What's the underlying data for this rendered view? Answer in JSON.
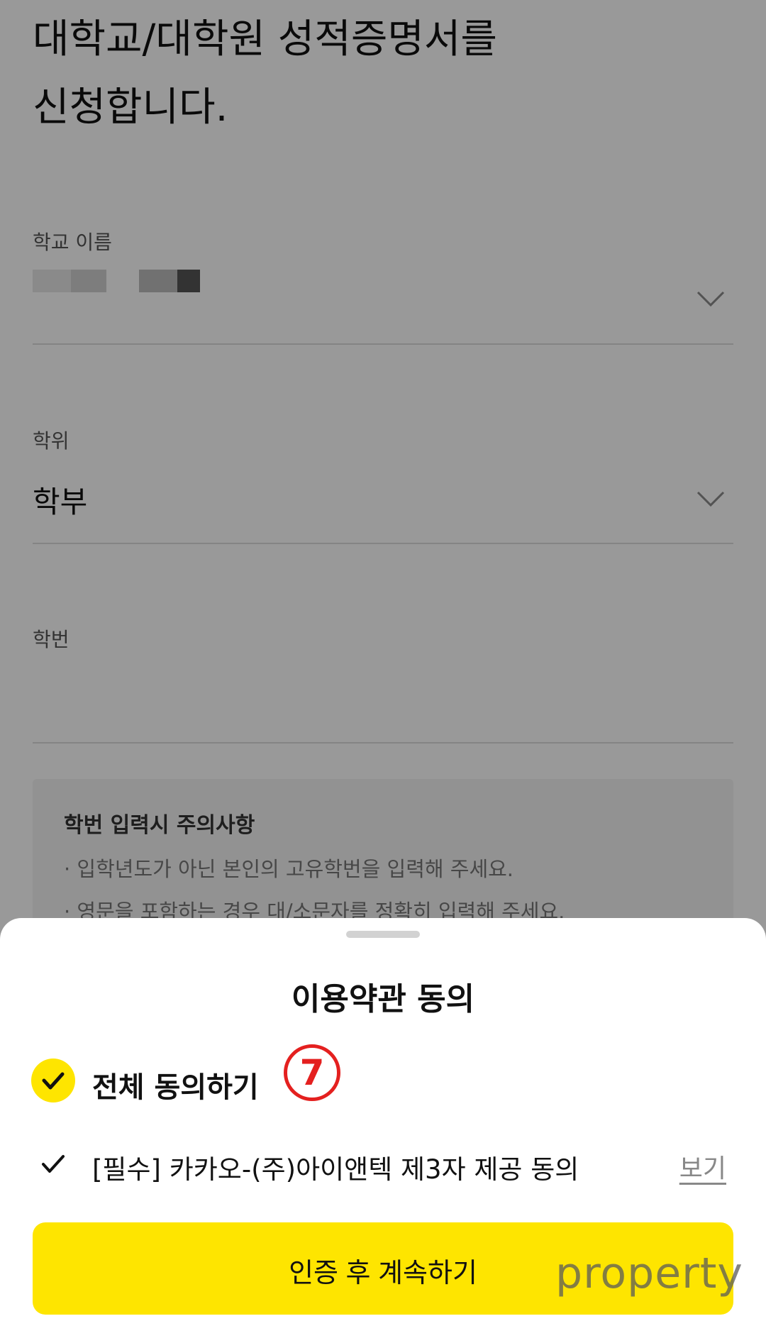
{
  "page": {
    "headline_line1_highlight": "대학교/대학원 성적증명서",
    "headline_line1_rest": "를",
    "headline_line2": "신청합니다."
  },
  "form": {
    "school_name": {
      "label": "학교 이름",
      "value": ""
    },
    "degree": {
      "label": "학위",
      "value": "학부"
    },
    "student_id": {
      "label": "학번",
      "value": ""
    }
  },
  "notice": {
    "title": "학번 입력시 주의사항",
    "items": [
      "· 입학년도가 아닌 본인의 고유학번을 입력해 주세요.",
      "· 영문을 포함하는 경우 대/소문자를 정확히 입력해 주세요."
    ]
  },
  "sheet": {
    "title": "이용약관 동의",
    "agree_all_label": "전체 동의하기",
    "step_marker": "7",
    "term_label": "[필수] 카카오-(주)아이앤텍 제3자 제공 동의",
    "term_view_label": "보기",
    "cta_label": "인증 후 계속하기"
  },
  "watermark": "property",
  "colors": {
    "accent_yellow": "#fee500",
    "marker_red": "#e4201f",
    "dim_overlay": "rgba(0,0,0,0.4)"
  },
  "icons": {
    "school_dropdown": "chevron-down-icon",
    "degree_dropdown": "chevron-down-icon",
    "agree_all_check": "check-icon",
    "term_check": "check-icon"
  }
}
